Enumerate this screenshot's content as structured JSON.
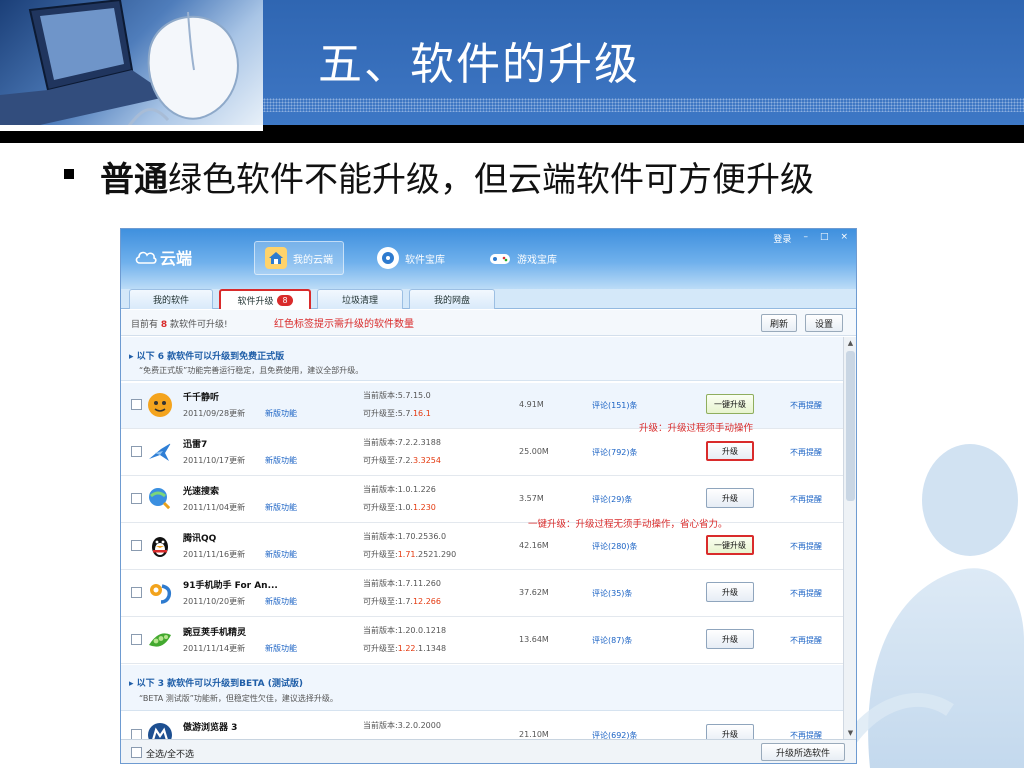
{
  "slide": {
    "title": "五、软件的升级",
    "bullet_bold": "普通",
    "bullet_rest": "绿色软件不能升级，但云端软件可方便升级"
  },
  "app": {
    "logo": "云端",
    "nav": [
      {
        "label": "我的云端",
        "icon": "house-icon"
      },
      {
        "label": "软件宝库",
        "icon": "disc-icon"
      },
      {
        "label": "游戏宝库",
        "icon": "gamepad-icon"
      }
    ],
    "window": {
      "login": "登录",
      "minimize": "–",
      "maximize": "□",
      "close": "×"
    },
    "tabs": [
      {
        "label": "我的软件"
      },
      {
        "label": "软件升级",
        "badge": "8"
      },
      {
        "label": "垃圾清理"
      },
      {
        "label": "我的网盘"
      }
    ],
    "info": {
      "prefix": "目前有",
      "count": "8",
      "suffix": "款软件可升级!",
      "annotation": "红色标签提示需升级的软件数量",
      "refresh": "刷新",
      "settings": "设置"
    },
    "section1": {
      "head": "▸ 以下 6 款软件可以升级到免费正式版",
      "sub": "“免费正式版”功能完善运行稳定，且免费使用，建议全部升级。"
    },
    "section2": {
      "head": "▸ 以下 3 款软件可以升级到BETA (测试版)",
      "sub": "“BETA 测试版”功能新，但稳定性欠佳，建议选择升级。"
    },
    "rows": [
      {
        "name": "千千静听",
        "date": "2011/09/28更新",
        "new": "新版功能",
        "cur": "当前版本:5.7.15.0",
        "up_pre": "可升级至:5.7.",
        "up_hi": "16.1",
        "up_post": "",
        "size": "4.91M",
        "comments": "评论(151)条",
        "btn": "一键升级",
        "remind": "不再提醒"
      },
      {
        "name": "迅雷7",
        "date": "2011/10/17更新",
        "new": "新版功能",
        "cur": "当前版本:7.2.2.3188",
        "up_pre": "可升级至:7.2.",
        "up_hi": "3.3254",
        "up_post": "",
        "size": "25.00M",
        "comments": "评论(792)条",
        "btn": "升级",
        "remind": "不再提醒"
      },
      {
        "name": "光速搜索",
        "date": "2011/11/04更新",
        "new": "新版功能",
        "cur": "当前版本:1.0.1.226",
        "up_pre": "可升级至:1.0.",
        "up_hi": "1.230",
        "up_post": "",
        "size": "3.57M",
        "comments": "评论(29)条",
        "btn": "升级",
        "remind": "不再提醒"
      },
      {
        "name": "腾讯QQ",
        "date": "2011/11/16更新",
        "new": "新版功能",
        "cur": "当前版本:1.70.2536.0",
        "up_pre": "可升级至:",
        "up_hi": "1.71",
        "up_post": ".2521.290",
        "size": "42.16M",
        "comments": "评论(280)条",
        "btn": "一键升级",
        "remind": "不再提醒"
      },
      {
        "name": "91手机助手 For An...",
        "date": "2011/10/20更新",
        "new": "新版功能",
        "cur": "当前版本:1.7.11.260",
        "up_pre": "可升级至:1.7.",
        "up_hi": "12.266",
        "up_post": "",
        "size": "37.62M",
        "comments": "评论(35)条",
        "btn": "升级",
        "remind": "不再提醒"
      },
      {
        "name": "豌豆荚手机精灵",
        "date": "2011/11/14更新",
        "new": "新版功能",
        "cur": "当前版本:1.20.0.1218",
        "up_pre": "可升级至:",
        "up_hi": "1.22",
        "up_post": ".1.1348",
        "size": "13.64M",
        "comments": "评论(87)条",
        "btn": "升级",
        "remind": "不再提醒"
      },
      {
        "name": "傲游浏览器 3",
        "date": "",
        "new": "",
        "cur": "当前版本:3.2.0.2000",
        "up_pre": "",
        "up_hi": "",
        "up_post": "",
        "size": "21.10M",
        "comments": "评论(692)条",
        "btn": "升级",
        "remind": "不再提醒"
      }
    ],
    "annotations": {
      "manual": "升级：升级过程须手动操作",
      "oneclick": "一键升级：升级过程无须手动操作，省心省力。"
    },
    "footer": {
      "select_all": "全选/全不选",
      "upgrade_selected": "升级所选软件"
    }
  }
}
